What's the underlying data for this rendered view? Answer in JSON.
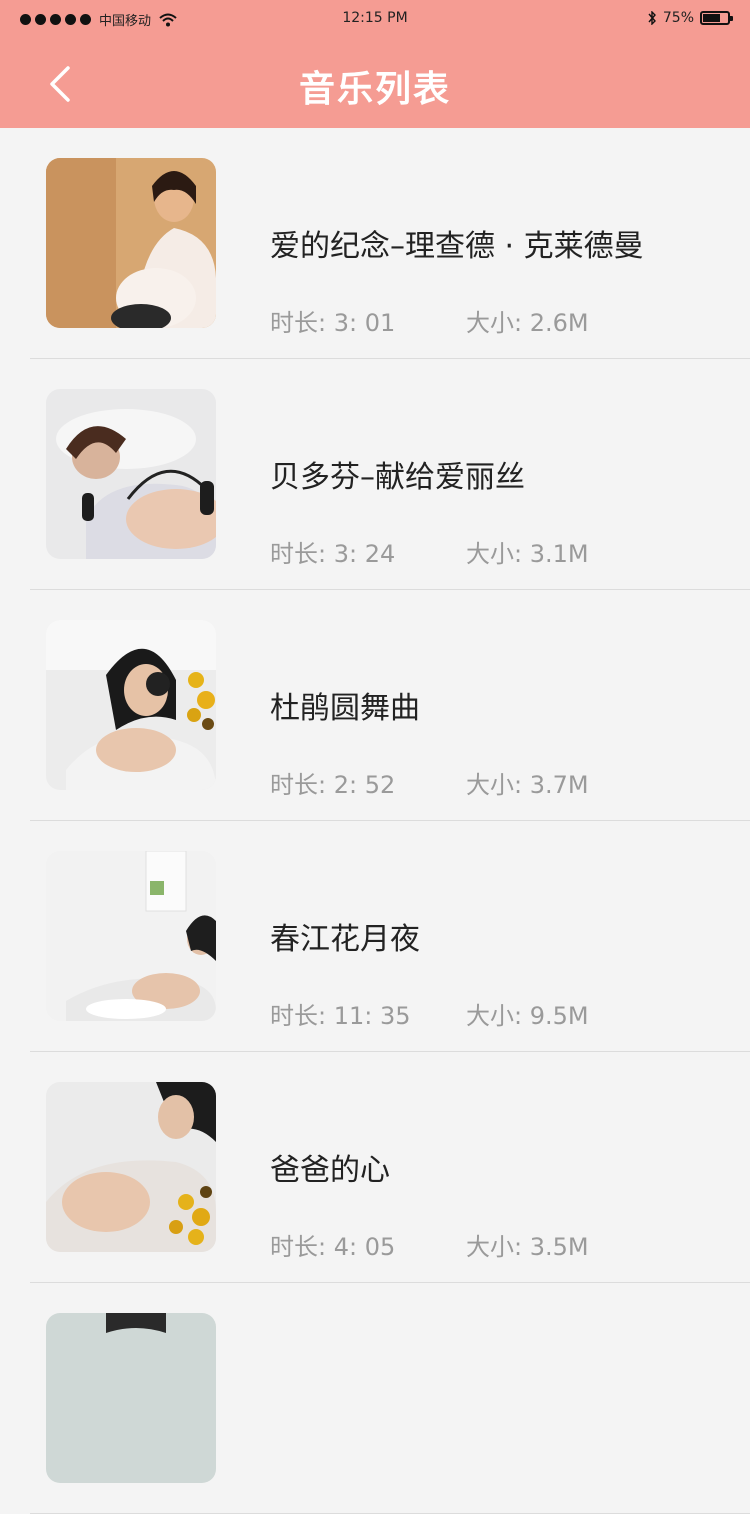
{
  "status_bar": {
    "carrier": "中国移动",
    "time": "12:15 PM",
    "battery": "75%",
    "battery_level": 0.75
  },
  "nav": {
    "title": "音乐列表",
    "back_icon": "chevron-left-icon"
  },
  "items": [
    {
      "title": "爱的纪念–理查德 · 克莱德曼",
      "duration": "时长: 3: 01",
      "size": "大小: 2.6M"
    },
    {
      "title": "贝多芬–献给爱丽丝",
      "duration": "时长: 3: 24",
      "size": "大小: 3.1M"
    },
    {
      "title": "杜鹃圆舞曲",
      "duration": "时长: 2: 52",
      "size": "大小: 3.7M"
    },
    {
      "title": "春江花月夜",
      "duration": "时长: 11: 35",
      "size": "大小: 9.5M"
    },
    {
      "title": "爸爸的心",
      "duration": "时长: 4: 05",
      "size": "大小: 3.5M"
    }
  ],
  "colors": {
    "accent": "#f59c93",
    "background": "#f4f4f4",
    "meta_text": "#9a9a9a"
  }
}
